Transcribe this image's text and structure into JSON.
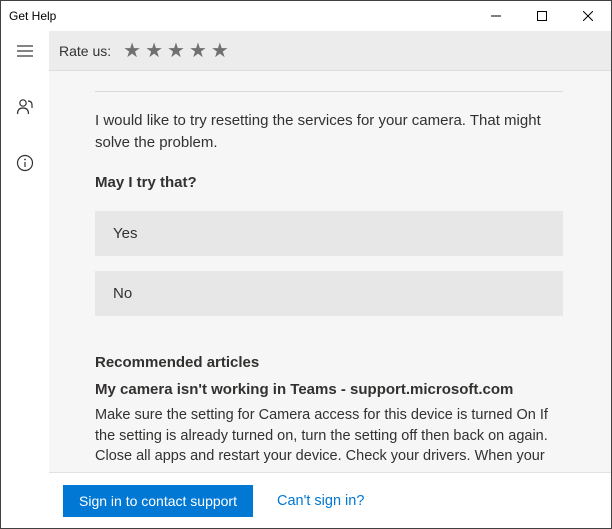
{
  "window": {
    "title": "Get Help"
  },
  "rate": {
    "label": "Rate us:"
  },
  "chat": {
    "message": "I would like to try resetting the services for your camera. That might solve the problem.",
    "question": "May I try that?",
    "option_yes": "Yes",
    "option_no": "No"
  },
  "articles": {
    "heading": "Recommended articles",
    "items": [
      {
        "title": "My camera isn't working in Teams - support.microsoft.com",
        "snippet": "Make sure the setting for Camera access for this device is turned On If the setting is already turned on, turn the setting off then back on again. Close all apps and restart your device. Check your drivers. When your camera"
      }
    ]
  },
  "footer": {
    "signin": "Sign in to contact support",
    "cant": "Can't sign in?"
  }
}
